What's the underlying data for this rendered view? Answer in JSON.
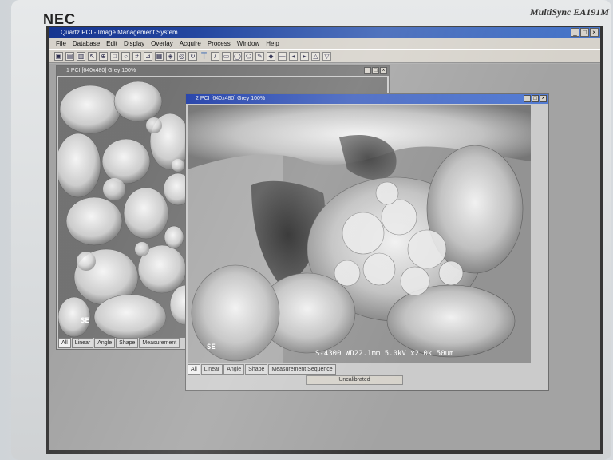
{
  "monitor": {
    "brand": "NEC",
    "model": "MultiSync EA191M"
  },
  "app": {
    "title": "Quartz PCI - Image Management System",
    "menu": [
      "File",
      "Database",
      "Edit",
      "Display",
      "Overlay",
      "Acquire",
      "Process",
      "Window",
      "Help"
    ],
    "window_buttons": [
      "_",
      "□",
      "×"
    ],
    "toolbar_text_tool": "T"
  },
  "child1": {
    "title": "1 PCI [640x480] Grey 100%",
    "label": "SE",
    "tabs": [
      "All",
      "Linear",
      "Angle",
      "Shape",
      "Measurement"
    ]
  },
  "child2": {
    "title": "2 PCI [640x480] Grey 100%",
    "label": "SE",
    "scale_text": "S-4300 WD22.1mm 5.0kV x2.0k 50um",
    "tabs": [
      "All",
      "Linear",
      "Angle",
      "Shape",
      "Measurement Sequence"
    ],
    "status": "Uncalibrated"
  }
}
